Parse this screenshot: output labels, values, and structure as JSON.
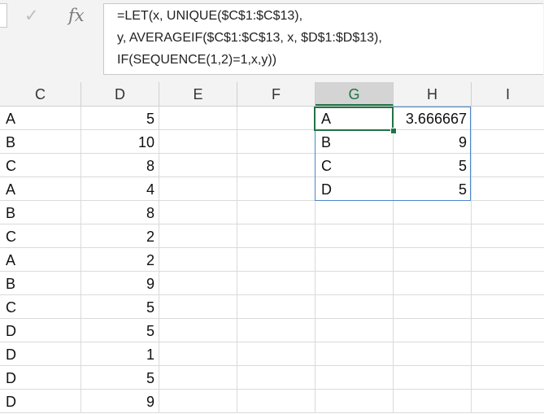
{
  "formula_bar": {
    "check_icon": "✓",
    "fx_icon": "fx",
    "formula_lines": [
      "=LET(x, UNIQUE($C$1:$C$13),",
      "y, AVERAGEIF($C$1:$C$13, x, $D$1:$D$13),",
      "IF(SEQUENCE(1,2)=1,x,y))"
    ]
  },
  "columns": [
    "C",
    "D",
    "E",
    "F",
    "G",
    "H",
    "I"
  ],
  "active_column": "G",
  "data": {
    "col_c": [
      "A",
      "B",
      "C",
      "A",
      "B",
      "C",
      "A",
      "B",
      "C",
      "D",
      "D",
      "D",
      "D"
    ],
    "col_d": [
      "5",
      "10",
      "8",
      "4",
      "8",
      "2",
      "2",
      "9",
      "5",
      "5",
      "1",
      "5",
      "9"
    ]
  },
  "results": {
    "col_g": [
      "A",
      "B",
      "C",
      "D"
    ],
    "col_h": [
      "3.666667",
      "9",
      "5",
      "5"
    ]
  },
  "colors": {
    "accent": "#217346",
    "spill_border": "#4a86c8",
    "gridline": "#dadada"
  }
}
